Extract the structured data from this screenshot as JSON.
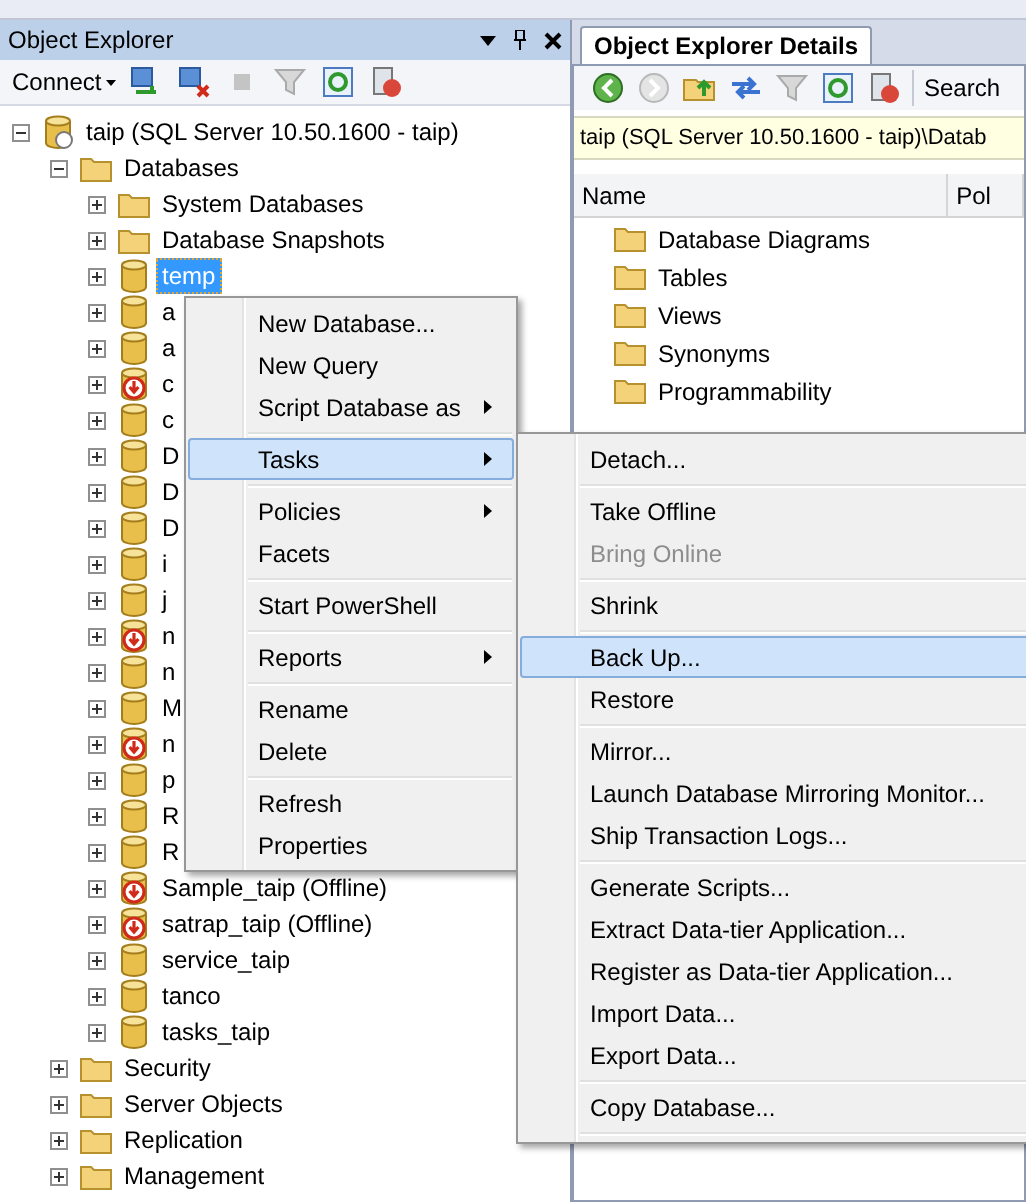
{
  "object_explorer": {
    "title": "Object Explorer",
    "connect": "Connect",
    "tree": [
      {
        "label": "taip (SQL Server 10.50.1600 - taip)",
        "kind": "server",
        "expanded": true,
        "selected": false,
        "children": [
          {
            "label": "Databases",
            "kind": "folder",
            "expanded": true,
            "selected": false,
            "children": [
              {
                "label": "System Databases",
                "kind": "folder",
                "expanded": false,
                "selected": false
              },
              {
                "label": "Database Snapshots",
                "kind": "folder",
                "expanded": false,
                "selected": false
              },
              {
                "label": "temp",
                "kind": "database",
                "expanded": false,
                "selected": true
              },
              {
                "label": "a",
                "kind": "database",
                "expanded": false,
                "selected": false
              },
              {
                "label": "a",
                "kind": "database",
                "expanded": false,
                "selected": false
              },
              {
                "label": "c",
                "kind": "offline",
                "expanded": false,
                "selected": false
              },
              {
                "label": "c",
                "kind": "database",
                "expanded": false,
                "selected": false
              },
              {
                "label": "D",
                "kind": "database",
                "expanded": false,
                "selected": false
              },
              {
                "label": "D",
                "kind": "database",
                "expanded": false,
                "selected": false
              },
              {
                "label": "D",
                "kind": "database",
                "expanded": false,
                "selected": false
              },
              {
                "label": "i",
                "kind": "database",
                "expanded": false,
                "selected": false
              },
              {
                "label": "j",
                "kind": "database",
                "expanded": false,
                "selected": false
              },
              {
                "label": "n",
                "kind": "offline",
                "expanded": false,
                "selected": false
              },
              {
                "label": "n",
                "kind": "database",
                "expanded": false,
                "selected": false
              },
              {
                "label": "M",
                "kind": "database",
                "expanded": false,
                "selected": false
              },
              {
                "label": "n",
                "kind": "offline",
                "expanded": false,
                "selected": false
              },
              {
                "label": "p",
                "kind": "database",
                "expanded": false,
                "selected": false
              },
              {
                "label": "R",
                "kind": "database",
                "expanded": false,
                "selected": false
              },
              {
                "label": "R",
                "kind": "database",
                "expanded": false,
                "selected": false
              },
              {
                "label": "Sample_taip (Offline)",
                "kind": "offline",
                "expanded": false,
                "selected": false
              },
              {
                "label": "satrap_taip (Offline)",
                "kind": "offline",
                "expanded": false,
                "selected": false
              },
              {
                "label": "service_taip",
                "kind": "database",
                "expanded": false,
                "selected": false
              },
              {
                "label": "tanco",
                "kind": "database",
                "expanded": false,
                "selected": false
              },
              {
                "label": "tasks_taip",
                "kind": "database",
                "expanded": false,
                "selected": false
              }
            ]
          },
          {
            "label": "Security",
            "kind": "folder",
            "expanded": false,
            "selected": false
          },
          {
            "label": "Server Objects",
            "kind": "folder",
            "expanded": false,
            "selected": false
          },
          {
            "label": "Replication",
            "kind": "folder",
            "expanded": false,
            "selected": false
          },
          {
            "label": "Management",
            "kind": "folder",
            "expanded": false,
            "selected": false
          }
        ]
      }
    ]
  },
  "details": {
    "tab": "Object Explorer Details",
    "search": "Search",
    "path": "taip (SQL Server 10.50.1600 - taip)\\Datab",
    "columns": [
      "Name",
      "Pol"
    ],
    "rows": [
      "Database Diagrams",
      "Tables",
      "Views",
      "Synonyms",
      "Programmability"
    ]
  },
  "context_menu": [
    {
      "kind": "item",
      "label": "New Database...",
      "submenu": false,
      "selected": false,
      "disabled": false
    },
    {
      "kind": "item",
      "label": "New Query",
      "submenu": false,
      "selected": false,
      "disabled": false
    },
    {
      "kind": "item",
      "label": "Script Database as",
      "submenu": true,
      "selected": false,
      "disabled": false
    },
    {
      "kind": "separator"
    },
    {
      "kind": "item",
      "label": "Tasks",
      "submenu": true,
      "selected": true,
      "disabled": false
    },
    {
      "kind": "separator"
    },
    {
      "kind": "item",
      "label": "Policies",
      "submenu": true,
      "selected": false,
      "disabled": false
    },
    {
      "kind": "item",
      "label": "Facets",
      "submenu": false,
      "selected": false,
      "disabled": false
    },
    {
      "kind": "separator"
    },
    {
      "kind": "item",
      "label": "Start PowerShell",
      "submenu": false,
      "selected": false,
      "disabled": false
    },
    {
      "kind": "separator"
    },
    {
      "kind": "item",
      "label": "Reports",
      "submenu": true,
      "selected": false,
      "disabled": false
    },
    {
      "kind": "separator"
    },
    {
      "kind": "item",
      "label": "Rename",
      "submenu": false,
      "selected": false,
      "disabled": false
    },
    {
      "kind": "item",
      "label": "Delete",
      "submenu": false,
      "selected": false,
      "disabled": false
    },
    {
      "kind": "separator"
    },
    {
      "kind": "item",
      "label": "Refresh",
      "submenu": false,
      "selected": false,
      "disabled": false
    },
    {
      "kind": "item",
      "label": "Properties",
      "submenu": false,
      "selected": false,
      "disabled": false
    }
  ],
  "tasks_submenu": [
    {
      "kind": "item",
      "label": "Detach...",
      "submenu": false,
      "selected": false,
      "disabled": false
    },
    {
      "kind": "separator"
    },
    {
      "kind": "item",
      "label": "Take Offline",
      "submenu": false,
      "selected": false,
      "disabled": false
    },
    {
      "kind": "item",
      "label": "Bring Online",
      "submenu": false,
      "selected": false,
      "disabled": true
    },
    {
      "kind": "separator"
    },
    {
      "kind": "item",
      "label": "Shrink",
      "submenu": false,
      "selected": false,
      "disabled": false
    },
    {
      "kind": "separator"
    },
    {
      "kind": "item",
      "label": "Back Up...",
      "submenu": false,
      "selected": true,
      "disabled": false
    },
    {
      "kind": "item",
      "label": "Restore",
      "submenu": false,
      "selected": false,
      "disabled": false
    },
    {
      "kind": "separator"
    },
    {
      "kind": "item",
      "label": "Mirror...",
      "submenu": false,
      "selected": false,
      "disabled": false
    },
    {
      "kind": "item",
      "label": "Launch Database Mirroring Monitor...",
      "submenu": false,
      "selected": false,
      "disabled": false
    },
    {
      "kind": "item",
      "label": "Ship Transaction Logs...",
      "submenu": false,
      "selected": false,
      "disabled": false
    },
    {
      "kind": "separator"
    },
    {
      "kind": "item",
      "label": "Generate Scripts...",
      "submenu": false,
      "selected": false,
      "disabled": false
    },
    {
      "kind": "item",
      "label": "Extract Data-tier Application...",
      "submenu": false,
      "selected": false,
      "disabled": false
    },
    {
      "kind": "item",
      "label": "Register as Data-tier Application...",
      "submenu": false,
      "selected": false,
      "disabled": false
    },
    {
      "kind": "item",
      "label": "Import Data...",
      "submenu": false,
      "selected": false,
      "disabled": false
    },
    {
      "kind": "item",
      "label": "Export Data...",
      "submenu": false,
      "selected": false,
      "disabled": false
    },
    {
      "kind": "separator"
    },
    {
      "kind": "item",
      "label": "Copy Database...",
      "submenu": false,
      "selected": false,
      "disabled": false
    },
    {
      "kind": "separator"
    }
  ]
}
